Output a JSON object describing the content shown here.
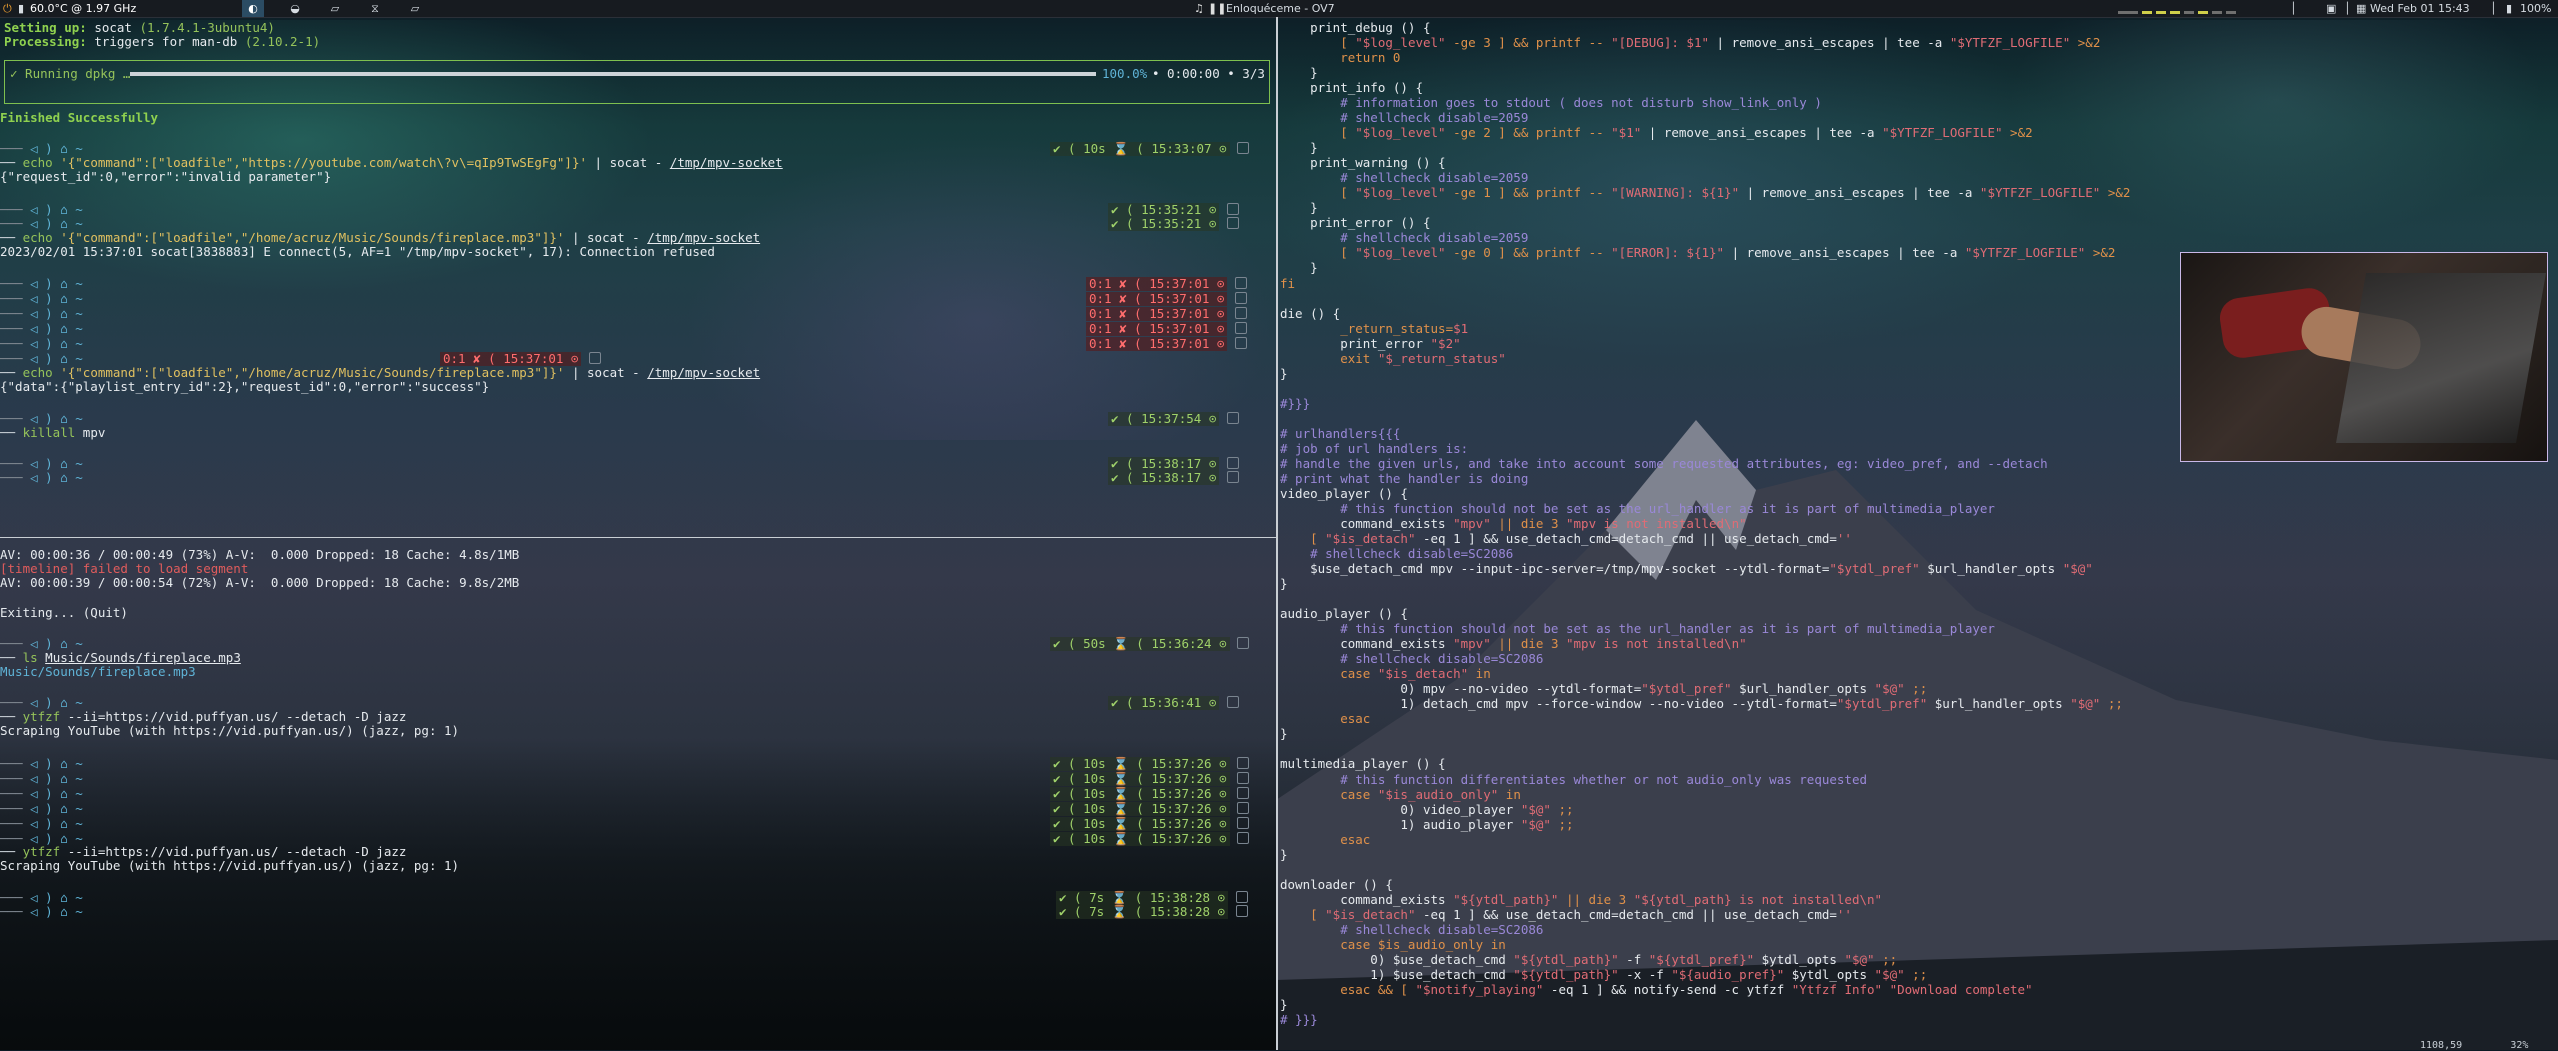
{
  "topbar": {
    "temp": "60.0°C @ 1.97 GHz",
    "workspaces": [
      "◐",
      "",
      "",
      "",
      "",
      ""
    ],
    "active_ws": 1,
    "music_label": "Enloquéceme - OV7",
    "clock": "Wed Feb 01 15:43",
    "battery": "100%"
  },
  "pane_top": {
    "setup_line": {
      "label": "Setting up:",
      "pkg": "socat",
      "ver": "(1.7.4.1-3ubuntu4)"
    },
    "processing_line": {
      "label": "Processing:",
      "text": "triggers for man-db",
      "ver": "(2.10.2-1)"
    },
    "dpkg": {
      "label": "✓ Running dpkg …",
      "percent": "100.0%",
      "time": "• 0:00:00 • 3/3",
      "progress": 1.0
    },
    "finished": "Finished Successfully",
    "prompt": "◁ ) ⌂ ~",
    "commands": [
      {
        "pre": "echo",
        "str": "'{\"command\":[\"loadfile\",\"https://youtube.com/watch\\?v\\=qIp9TwSEgFg\"]}'",
        "pipe": "| socat - ",
        "path": "/tmp/mpv-socket"
      },
      {
        "pre": "echo",
        "str": "'{\"command\":[\"loadfile\",\"/home/acruz/Music/Sounds/fireplace.mp3\"]}'",
        "pipe": "| socat - ",
        "path": "/tmp/mpv-socket"
      },
      {
        "pre": "echo",
        "str": "'{\"command\":[\"loadfile\",\"/home/acruz/Music/Sounds/fireplace.mp3\"]}'",
        "pipe": "| socat - ",
        "path": "/tmp/mpv-socket"
      },
      {
        "pre": "killall",
        "arg": "mpv"
      }
    ],
    "outputs": [
      "{\"request_id\":0,\"error\":\"invalid parameter\"}",
      "2023/02/01 15:37:01 socat[3838883] E connect(5, AF=1 \"/tmp/mpv-socket\", 17): Connection refused",
      "{\"data\":{\"playlist_entry_id\":2},\"request_id\":0,\"error\":\"success\"}"
    ],
    "times": {
      "t1": "✔ ( 10s ⌛ ( 15:33:07 ⊙",
      "t2a": "✔ ( 15:35:21 ⊙",
      "t2b": "✔ ( 15:35:21 ⊙",
      "t3": "✔ ( 15:37:01 ⊙",
      "err": "0:1 ✘ ( 15:37:01 ⊙",
      "mid_err": "0:1 ✘ ( 15:37:01 ⊙",
      "t4": "✔ ( 15:37:54 ⊙",
      "t5a": "✔ ( 15:38:17 ⊙",
      "t5b": "✔ ( 15:38:17 ⊙"
    }
  },
  "pane_bottom": {
    "av1": "AV: 00:00:36 / 00:00:49 (73%) A-V:  0.000 Dropped: 18 Cache: 4.8s/1MB",
    "timeline_err": "[timeline] failed to load segment",
    "av2": "AV: 00:00:39 / 00:00:54 (72%) A-V:  0.000 Dropped: 18 Cache: 9.8s/2MB",
    "exiting": "Exiting... (Quit)",
    "ls_cmd": "ls",
    "ls_arg": "Music/Sounds/fireplace.mp3",
    "ls_out": "Music/Sounds/fireplace.mp3",
    "ytfzf_cmd": "ytfzf",
    "ytfzf_args": "--ii=https://vid.puffyan.us/ --detach -D jazz",
    "scraping": "Scraping YouTube (with https://vid.puffyan.us/) (jazz, pg: 1)",
    "times": {
      "b1": "✔ ( 50s ⌛ ( 15:36:24 ⊙",
      "b2": "✔ ( 15:36:41 ⊙",
      "b3": "✔ ( 10s ⌛ ( 15:37:26 ⊙",
      "b4": "✔ ( 7s ⌛ ( 15:38:28 ⊙"
    }
  },
  "editor": {
    "lines": [
      [
        {
          "t": "    print_debug () {",
          "c": "wh"
        }
      ],
      [
        {
          "t": "        [ ",
          "c": "or"
        },
        {
          "t": "\"$log_level\"",
          "c": "pk"
        },
        {
          "t": " -ge 3 ] && printf -- ",
          "c": "or"
        },
        {
          "t": "\"[DEBUG]: $1\"",
          "c": "pk"
        },
        {
          "t": " | remove_ansi_escapes | tee -a ",
          "c": "wh"
        },
        {
          "t": "\"$YTFZF_LOGFILE\"",
          "c": "pk"
        },
        {
          "t": " >&2",
          "c": "or"
        }
      ],
      [
        {
          "t": "        return 0",
          "c": "or"
        }
      ],
      [
        {
          "t": "    }",
          "c": "wh"
        }
      ],
      [
        {
          "t": "    print_info () {",
          "c": "wh"
        }
      ],
      [
        {
          "t": "        # information goes to stdout ( does not disturb show_link_only )",
          "c": "cmt"
        }
      ],
      [
        {
          "t": "        # shellcheck disable=2059",
          "c": "cmt"
        }
      ],
      [
        {
          "t": "        [ ",
          "c": "or"
        },
        {
          "t": "\"$log_level\"",
          "c": "pk"
        },
        {
          "t": " -ge 2 ] && printf -- ",
          "c": "or"
        },
        {
          "t": "\"$1\"",
          "c": "pk"
        },
        {
          "t": " | remove_ansi_escapes | tee -a ",
          "c": "wh"
        },
        {
          "t": "\"$YTFZF_LOGFILE\"",
          "c": "pk"
        },
        {
          "t": " >&2",
          "c": "or"
        }
      ],
      [
        {
          "t": "    }",
          "c": "wh"
        }
      ],
      [
        {
          "t": "    print_warning () {",
          "c": "wh"
        }
      ],
      [
        {
          "t": "        # shellcheck disable=2059",
          "c": "cmt"
        }
      ],
      [
        {
          "t": "        [ ",
          "c": "or"
        },
        {
          "t": "\"$log_level\"",
          "c": "pk"
        },
        {
          "t": " -ge 1 ] && printf -- ",
          "c": "or"
        },
        {
          "t": "\"[WARNING]: ${1}\"",
          "c": "pk"
        },
        {
          "t": " | remove_ansi_escapes | tee -a ",
          "c": "wh"
        },
        {
          "t": "\"$YTFZF_LOGFILE\"",
          "c": "pk"
        },
        {
          "t": " >&2",
          "c": "or"
        }
      ],
      [
        {
          "t": "    }",
          "c": "wh"
        }
      ],
      [
        {
          "t": "    print_error () {",
          "c": "wh"
        }
      ],
      [
        {
          "t": "        # shellcheck disable=2059",
          "c": "cmt"
        }
      ],
      [
        {
          "t": "        [ ",
          "c": "or"
        },
        {
          "t": "\"$log_level\"",
          "c": "pk"
        },
        {
          "t": " -ge 0 ] && printf -- ",
          "c": "or"
        },
        {
          "t": "\"[ERROR]: ${1}\"",
          "c": "pk"
        },
        {
          "t": " | remove_ansi_escapes | tee -a ",
          "c": "wh"
        },
        {
          "t": "\"$YTFZF_LOGFILE\"",
          "c": "pk"
        },
        {
          "t": " >&2",
          "c": "or"
        }
      ],
      [
        {
          "t": "    }",
          "c": "wh"
        }
      ],
      [
        {
          "t": "fi",
          "c": "or"
        }
      ],
      [
        {
          "t": "",
          "c": "wh"
        }
      ],
      [
        {
          "t": "die () {",
          "c": "wh"
        }
      ],
      [
        {
          "t": "        _return_status=",
          "c": "or"
        },
        {
          "t": "$1",
          "c": "pk"
        }
      ],
      [
        {
          "t": "        print_error ",
          "c": "wh"
        },
        {
          "t": "\"$2\"",
          "c": "pk"
        }
      ],
      [
        {
          "t": "        exit ",
          "c": "or"
        },
        {
          "t": "\"$_return_status\"",
          "c": "pk"
        }
      ],
      [
        {
          "t": "}",
          "c": "wh"
        }
      ],
      [
        {
          "t": "",
          "c": "wh"
        }
      ],
      [
        {
          "t": "#}}}",
          "c": "cmt"
        }
      ],
      [
        {
          "t": "",
          "c": "wh"
        }
      ],
      [
        {
          "t": "# urlhandlers{{{",
          "c": "cmt"
        }
      ],
      [
        {
          "t": "# job of url handlers is:",
          "c": "cmt"
        }
      ],
      [
        {
          "t": "# handle the given urls, and take into account some requested attributes, eg: video_pref, and --detach",
          "c": "cmt"
        }
      ],
      [
        {
          "t": "# print what the handler is doing",
          "c": "cmt"
        }
      ],
      [
        {
          "t": "video_player () {",
          "c": "wh"
        }
      ],
      [
        {
          "t": "        # this function should not be set as the url_handler as it is part of multimedia_player",
          "c": "cmt"
        }
      ],
      [
        {
          "t": "        command_exists ",
          "c": "wh"
        },
        {
          "t": "\"mpv\"",
          "c": "pk"
        },
        {
          "t": " || die 3 ",
          "c": "or"
        },
        {
          "t": "\"mpv is not installed\\n\"",
          "c": "pk"
        }
      ],
      [
        {
          "t": "    [ ",
          "c": "or"
        },
        {
          "t": "\"$is_detach\"",
          "c": "pk"
        },
        {
          "t": " -eq 1 ] && use_detach_cmd=detach_cmd || use_detach_cmd=",
          "c": "wh"
        },
        {
          "t": "''",
          "c": "pk"
        }
      ],
      [
        {
          "t": "    # shellcheck disable=SC2086",
          "c": "cmt"
        }
      ],
      [
        {
          "t": "    $use_detach_cmd mpv --input-ipc-server=/tmp/mpv-socket",
          "c": "wh"
        },
        {
          "t": " --ytdl-format=",
          "c": "wh"
        },
        {
          "t": "\"$ytdl_pref\"",
          "c": "pk"
        },
        {
          "t": " $url_handler_opts ",
          "c": "wh"
        },
        {
          "t": "\"$@\"",
          "c": "pk"
        }
      ],
      [
        {
          "t": "}",
          "c": "wh"
        }
      ],
      [
        {
          "t": "",
          "c": "wh"
        }
      ],
      [
        {
          "t": "audio_player () {",
          "c": "wh"
        }
      ],
      [
        {
          "t": "        # this function should not be set as the url_handler as it is part of multimedia_player",
          "c": "cmt"
        }
      ],
      [
        {
          "t": "        command_exists ",
          "c": "wh"
        },
        {
          "t": "\"mpv\"",
          "c": "pk"
        },
        {
          "t": " || die 3 ",
          "c": "or"
        },
        {
          "t": "\"mpv is not installed\\n\"",
          "c": "pk"
        }
      ],
      [
        {
          "t": "        # shellcheck disable=SC2086",
          "c": "cmt"
        }
      ],
      [
        {
          "t": "        case ",
          "c": "or"
        },
        {
          "t": "\"$is_detach\"",
          "c": "pk"
        },
        {
          "t": " in",
          "c": "or"
        }
      ],
      [
        {
          "t": "                0) mpv --no-video --ytdl-format=",
          "c": "wh"
        },
        {
          "t": "\"$ytdl_pref\"",
          "c": "pk"
        },
        {
          "t": " $url_handler_opts ",
          "c": "wh"
        },
        {
          "t": "\"$@\"",
          "c": "pk"
        },
        {
          "t": " ;;",
          "c": "or"
        }
      ],
      [
        {
          "t": "                1) detach_cmd mpv --force-window --no-video --ytdl-format=",
          "c": "wh"
        },
        {
          "t": "\"$ytdl_pref\"",
          "c": "pk"
        },
        {
          "t": " $url_handler_opts ",
          "c": "wh"
        },
        {
          "t": "\"$@\"",
          "c": "pk"
        },
        {
          "t": " ;;",
          "c": "or"
        }
      ],
      [
        {
          "t": "        esac",
          "c": "or"
        }
      ],
      [
        {
          "t": "}",
          "c": "wh"
        }
      ],
      [
        {
          "t": "",
          "c": "wh"
        }
      ],
      [
        {
          "t": "multimedia_player () {",
          "c": "wh"
        }
      ],
      [
        {
          "t": "        # this function differentiates whether or not audio_only was requested",
          "c": "cmt"
        }
      ],
      [
        {
          "t": "        case ",
          "c": "or"
        },
        {
          "t": "\"$is_audio_only\"",
          "c": "pk"
        },
        {
          "t": " in",
          "c": "or"
        }
      ],
      [
        {
          "t": "                0) video_player ",
          "c": "wh"
        },
        {
          "t": "\"$@\"",
          "c": "pk"
        },
        {
          "t": " ;;",
          "c": "or"
        }
      ],
      [
        {
          "t": "                1) audio_player ",
          "c": "wh"
        },
        {
          "t": "\"$@\"",
          "c": "pk"
        },
        {
          "t": " ;;",
          "c": "or"
        }
      ],
      [
        {
          "t": "        esac",
          "c": "or"
        }
      ],
      [
        {
          "t": "}",
          "c": "wh"
        }
      ],
      [
        {
          "t": "",
          "c": "wh"
        }
      ],
      [
        {
          "t": "downloader () {",
          "c": "wh"
        }
      ],
      [
        {
          "t": "        command_exists ",
          "c": "wh"
        },
        {
          "t": "\"${ytdl_path}\"",
          "c": "pk"
        },
        {
          "t": " || die 3 ",
          "c": "or"
        },
        {
          "t": "\"${ytdl_path} is not installed\\n\"",
          "c": "pk"
        }
      ],
      [
        {
          "t": "    [ ",
          "c": "or"
        },
        {
          "t": "\"$is_detach\"",
          "c": "pk"
        },
        {
          "t": " -eq 1 ] && use_detach_cmd=detach_cmd || use_detach_cmd=",
          "c": "wh"
        },
        {
          "t": "''",
          "c": "pk"
        }
      ],
      [
        {
          "t": "        # shellcheck disable=SC2086",
          "c": "cmt"
        }
      ],
      [
        {
          "t": "        case $is_audio_only in",
          "c": "or"
        }
      ],
      [
        {
          "t": "            0) $use_detach_cmd ",
          "c": "wh"
        },
        {
          "t": "\"${ytdl_path}\"",
          "c": "pk"
        },
        {
          "t": " -f ",
          "c": "wh"
        },
        {
          "t": "\"${ytdl_pref}\"",
          "c": "pk"
        },
        {
          "t": " $ytdl_opts ",
          "c": "wh"
        },
        {
          "t": "\"$@\"",
          "c": "pk"
        },
        {
          "t": " ;;",
          "c": "or"
        }
      ],
      [
        {
          "t": "            1) $use_detach_cmd ",
          "c": "wh"
        },
        {
          "t": "\"${ytdl_path}\"",
          "c": "pk"
        },
        {
          "t": " -x -f ",
          "c": "wh"
        },
        {
          "t": "\"${audio_pref}\"",
          "c": "pk"
        },
        {
          "t": " $ytdl_opts ",
          "c": "wh"
        },
        {
          "t": "\"$@\"",
          "c": "pk"
        },
        {
          "t": " ;;",
          "c": "or"
        }
      ],
      [
        {
          "t": "        esac && [ ",
          "c": "or"
        },
        {
          "t": "\"$notify_playing\"",
          "c": "pk"
        },
        {
          "t": " -eq 1 ] && notify-send -c ytfzf ",
          "c": "wh"
        },
        {
          "t": "\"Ytfzf Info\" \"Download complete\"",
          "c": "pk"
        }
      ],
      [
        {
          "t": "}",
          "c": "wh"
        }
      ],
      [
        {
          "t": "# }}}",
          "c": "cmt"
        }
      ]
    ],
    "status_pos": "1108,59",
    "status_pct": "32%"
  },
  "colors": {
    "accent_green": "#95c35a",
    "error_red": "#e05c5c",
    "comment": "#9a88d8",
    "keyword": "#e0914a",
    "string": "#e06c75"
  }
}
